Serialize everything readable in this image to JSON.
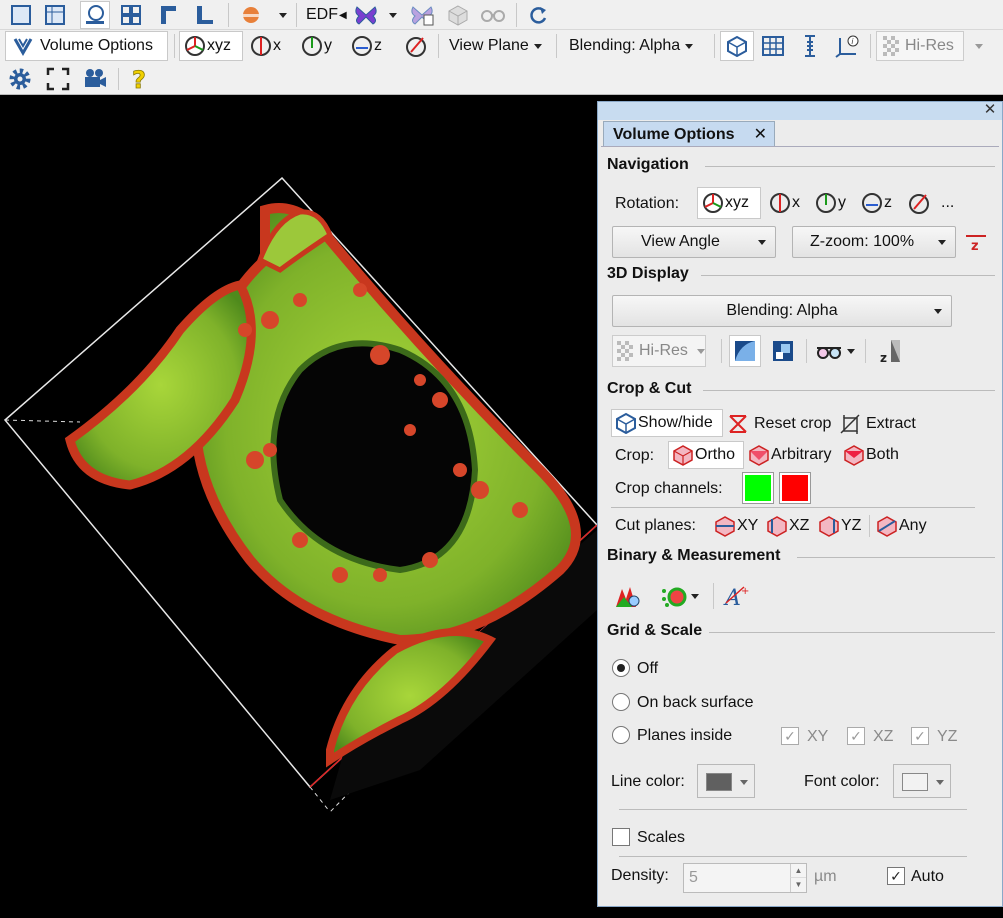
{
  "toolbar1": {
    "edf_label": "EDF",
    "icons": [
      "single-view-icon",
      "gallery-view-icon",
      "3d-view-icon",
      "grid-view-icon",
      "section-view-icon",
      "profile-view-icon",
      "surface-icon",
      "butterfly-icon",
      "butterfly-copy-icon",
      "cube-icon",
      "glasses-icon",
      "refresh-icon"
    ]
  },
  "toolbar2": {
    "volume_options_label": "Volume Options",
    "rot_xyz": "xyz",
    "rot_x": "x",
    "rot_y": "y",
    "rot_z": "z",
    "view_plane": "View Plane",
    "blending": "Blending: Alpha",
    "hires": "Hi-Res"
  },
  "panel": {
    "tab_title": "Volume Options",
    "navigation": {
      "title": "Navigation",
      "rotation_label": "Rotation:",
      "xyz": "xyz",
      "x": "x",
      "y": "y",
      "z": "z",
      "more": "...",
      "view_angle": "View Angle",
      "zzoom": "Z-zoom: 100%"
    },
    "display3d": {
      "title": "3D Display",
      "blending": "Blending: Alpha",
      "hires": "Hi-Res"
    },
    "crop": {
      "title": "Crop & Cut",
      "show_hide": "Show/hide",
      "reset_crop": "Reset crop",
      "extract": "Extract",
      "crop_label": "Crop:",
      "ortho": "Ortho",
      "arbitrary": "Arbitrary",
      "both": "Both",
      "crop_channels_label": "Crop channels:",
      "channel_colors": [
        "#00ff00",
        "#ff0000"
      ],
      "cut_planes_label": "Cut planes:",
      "xy": "XY",
      "xz": "XZ",
      "yz": "YZ",
      "any": "Any"
    },
    "binary": {
      "title": "Binary & Measurement"
    },
    "grid": {
      "title": "Grid & Scale",
      "off": "Off",
      "on_back": "On back surface",
      "planes_inside": "Planes inside",
      "xy": "XY",
      "xz": "XZ",
      "yz": "YZ",
      "line_color_label": "Line color:",
      "line_color": "#606060",
      "font_color_label": "Font color:",
      "font_color": "#f2f2f2",
      "scales": "Scales",
      "density_label": "Density:",
      "density_value": "5",
      "unit": "µm",
      "auto": "Auto"
    }
  }
}
